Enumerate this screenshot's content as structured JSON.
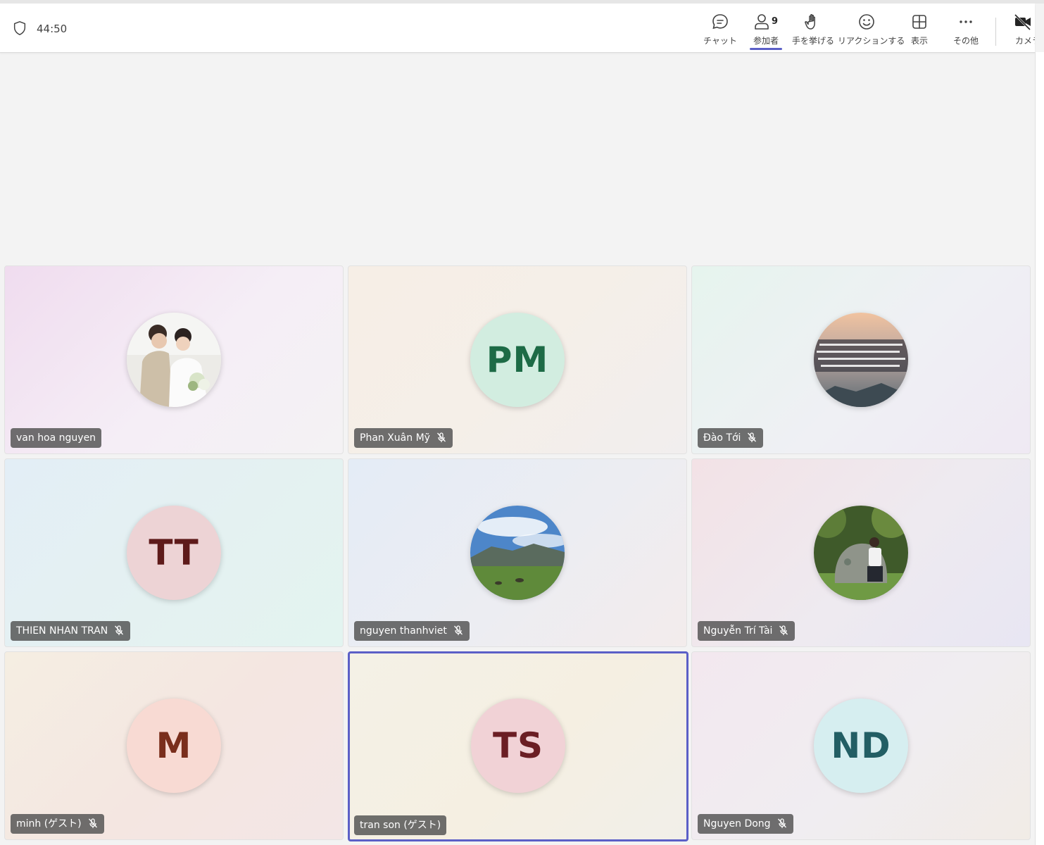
{
  "toolbar": {
    "timer": "44:50",
    "chat_label": "チャット",
    "participants_label": "参加者",
    "participants_count": "9",
    "raise_hand_label": "手を挙げる",
    "react_label": "リアクションする",
    "view_label": "表示",
    "more_label": "その他",
    "camera_label": "カメラ"
  },
  "colors": {
    "accent": "#5b5fc7",
    "nametag_bg": "#505050"
  },
  "participants": [
    {
      "name": "van hoa nguyen",
      "avatar": "photo",
      "muted": false
    },
    {
      "name": "Phan Xuân Mỹ",
      "initials": "PM",
      "muted": true
    },
    {
      "name": "Đào Tới",
      "avatar": "photo",
      "muted": true
    },
    {
      "name": "THIEN NHAN TRAN",
      "initials": "TT",
      "muted": true
    },
    {
      "name": "nguyen thanhviet",
      "avatar": "photo",
      "muted": true
    },
    {
      "name": "Nguyễn Trí Tài",
      "avatar": "photo",
      "muted": true
    },
    {
      "name": "minh (ゲスト)",
      "initials": "M",
      "muted": true
    },
    {
      "name": "tran son (ゲスト)",
      "initials": "TS",
      "muted": false,
      "selected": true
    },
    {
      "name": "Nguyen Dong",
      "initials": "ND",
      "muted": true
    }
  ]
}
